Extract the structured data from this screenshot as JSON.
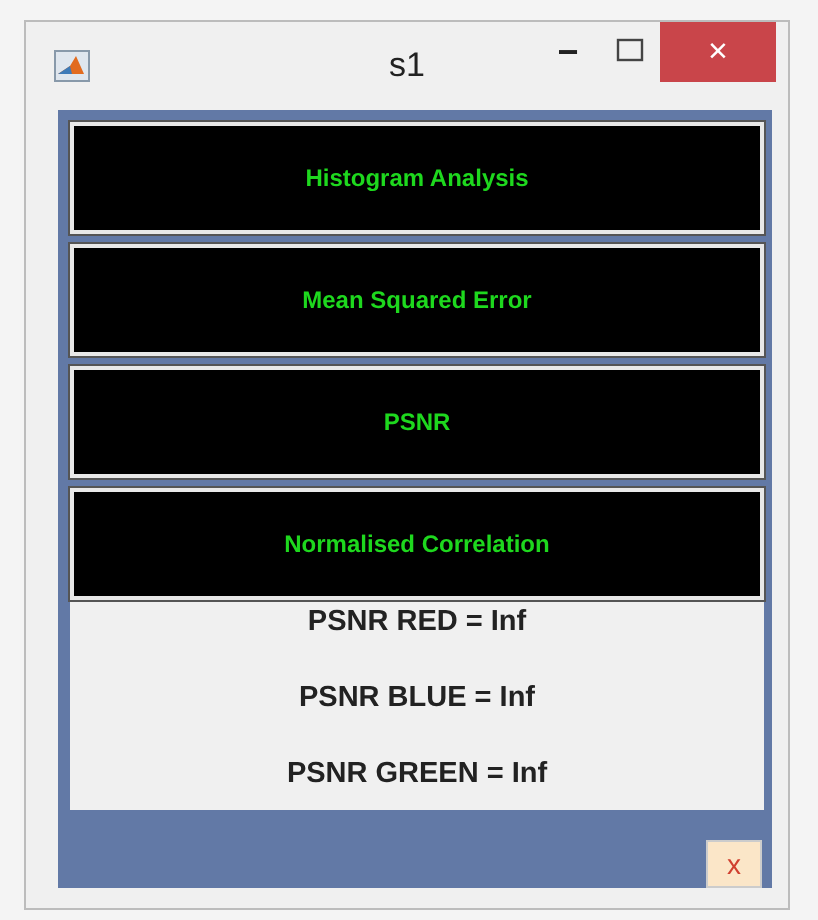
{
  "window": {
    "title": "s1",
    "title_buttons": [
      "−",
      "×"
    ]
  },
  "buttons": [
    {
      "label": "Histogram Analysis"
    },
    {
      "label": "Mean Squared Error"
    },
    {
      "label": "PSNR"
    },
    {
      "label": "Normalised Correlation"
    }
  ],
  "results": [
    "PSNR RED = Inf",
    "PSNR BLUE = Inf",
    "PSNR GREEN = Inf"
  ],
  "close_button": {
    "label": "x"
  }
}
